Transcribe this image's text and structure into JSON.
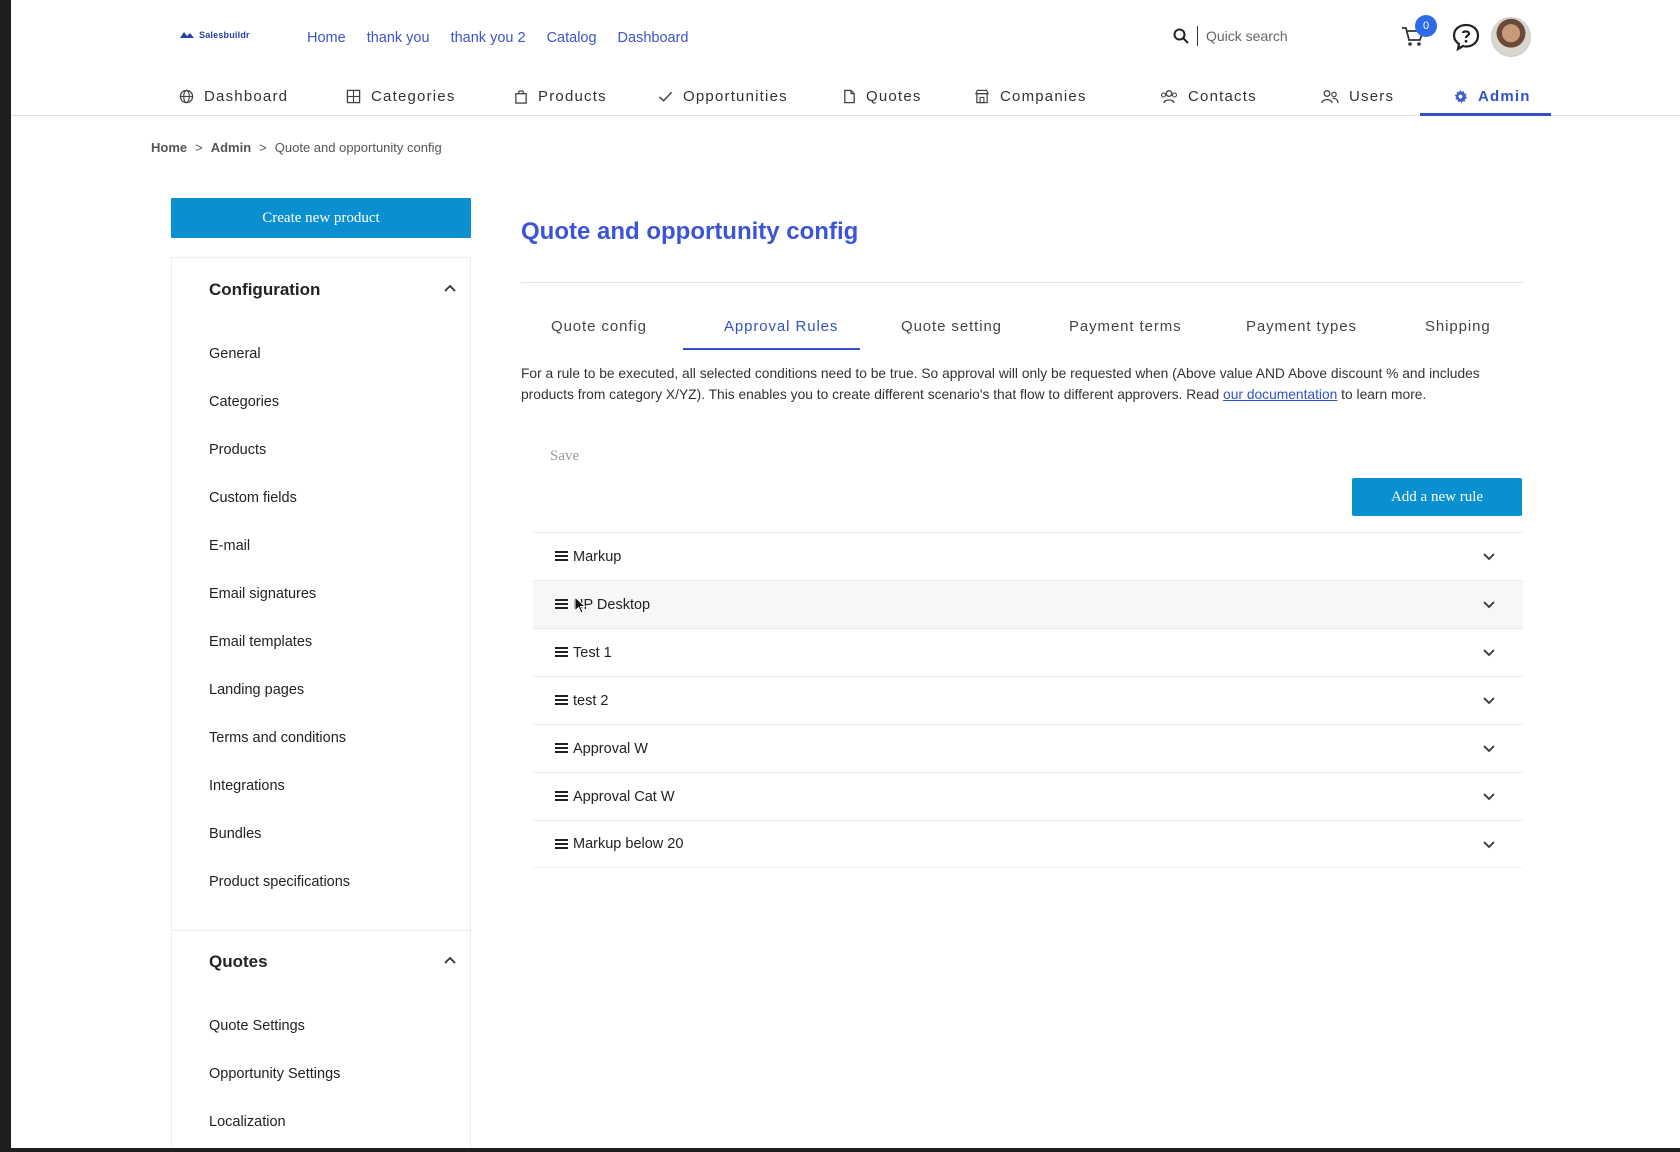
{
  "brand": {
    "name": "Salesbuildr",
    "color": "#2a3fa8"
  },
  "top_links": [
    "Home",
    "thank you",
    "thank you 2",
    "Catalog",
    "Dashboard"
  ],
  "search": {
    "placeholder": "Quick search"
  },
  "cart": {
    "count": "0"
  },
  "nav": [
    {
      "label": "Dashboard",
      "icon": "globe-icon"
    },
    {
      "label": "Categories",
      "icon": "grid-icon"
    },
    {
      "label": "Products",
      "icon": "bag-icon"
    },
    {
      "label": "Opportunities",
      "icon": "check-icon"
    },
    {
      "label": "Quotes",
      "icon": "document-icon"
    },
    {
      "label": "Companies",
      "icon": "store-icon"
    },
    {
      "label": "Contacts",
      "icon": "people-icon"
    },
    {
      "label": "Users",
      "icon": "users-icon"
    },
    {
      "label": "Admin",
      "icon": "gear-icon",
      "active": true
    }
  ],
  "breadcrumb": {
    "home": "Home",
    "sep": ">",
    "admin": "Admin",
    "current": "Quote and opportunity config"
  },
  "sidebar": {
    "create_button": "Create new product",
    "sections": [
      {
        "title": "Configuration",
        "items": [
          "General",
          "Categories",
          "Products",
          "Custom fields",
          "E-mail",
          "Email signatures",
          "Email templates",
          "Landing pages",
          "Terms and conditions",
          "Integrations",
          "Bundles",
          "Product specifications"
        ]
      },
      {
        "title": "Quotes",
        "items": [
          "Quote Settings",
          "Opportunity Settings",
          "Localization"
        ]
      }
    ]
  },
  "main": {
    "title": "Quote and opportunity config",
    "tabs": [
      "Quote config",
      "Approval Rules",
      "Quote setting",
      "Payment terms",
      "Payment types",
      "Shipping"
    ],
    "active_tab": "Approval Rules",
    "description_pre": "For a rule to be executed, all selected conditions need to be true. So approval will only be requested when (Above value AND Above discount % and includes products from category X/YZ). This enables you to create different scenario's that flow to different approvers. Read ",
    "description_link": "our documentation",
    "description_post": " to learn more.",
    "save_label": "Save",
    "add_rule_label": "Add a new rule",
    "rules": [
      "Markup",
      "HP Desktop",
      "Test 1",
      "test 2",
      "Approval W",
      "Approval Cat W",
      "Markup below 20"
    ]
  },
  "colors": {
    "accent": "#2f52c8",
    "button": "#0a8fd0",
    "title": "#3c55d8"
  }
}
